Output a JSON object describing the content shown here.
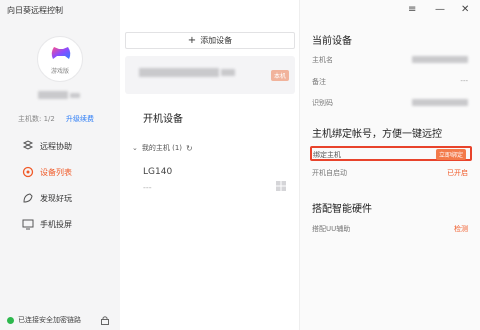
{
  "app": {
    "title": "向日葵远程控制"
  },
  "window_controls": {
    "menu": "≡",
    "minimize": "—",
    "close": "✕"
  },
  "sidebar": {
    "avatar_badge": "游戏版",
    "host_count_label": "主机数: 1/2",
    "upgrade_label": "升级续费",
    "nav": [
      {
        "label": "远程协助",
        "icon": "remote-assist-icon",
        "active": false
      },
      {
        "label": "设备列表",
        "icon": "device-list-icon",
        "active": true
      },
      {
        "label": "发现好玩",
        "icon": "discover-icon",
        "active": false
      },
      {
        "label": "手机投屏",
        "icon": "screen-mirror-icon",
        "active": false
      }
    ],
    "status": "已连接安全加密链路"
  },
  "middle": {
    "add_device_label": "添加设备",
    "local_tag": "本机",
    "section_title": "开机设备",
    "group_label": "我的主机 (1)",
    "device": {
      "name": "LG140",
      "status": "---"
    }
  },
  "right": {
    "current_device_title": "当前设备",
    "host_name_label": "主机名",
    "remark_label": "备注",
    "remark_value": "---",
    "code_label": "识别码",
    "bind_title": "主机绑定帐号，方便一键远控",
    "bind_label": "绑定主机",
    "bind_button": "立即绑定",
    "autostart_label": "开机自启动",
    "autostart_value": "已开启",
    "hardware_title": "搭配智能硬件",
    "uu_label": "搭配UU辅助",
    "uu_value": "检测"
  },
  "colors": {
    "accent": "#f05a28",
    "link": "#2b7cf6",
    "highlight": "#e8432b",
    "online": "#2db84d"
  }
}
